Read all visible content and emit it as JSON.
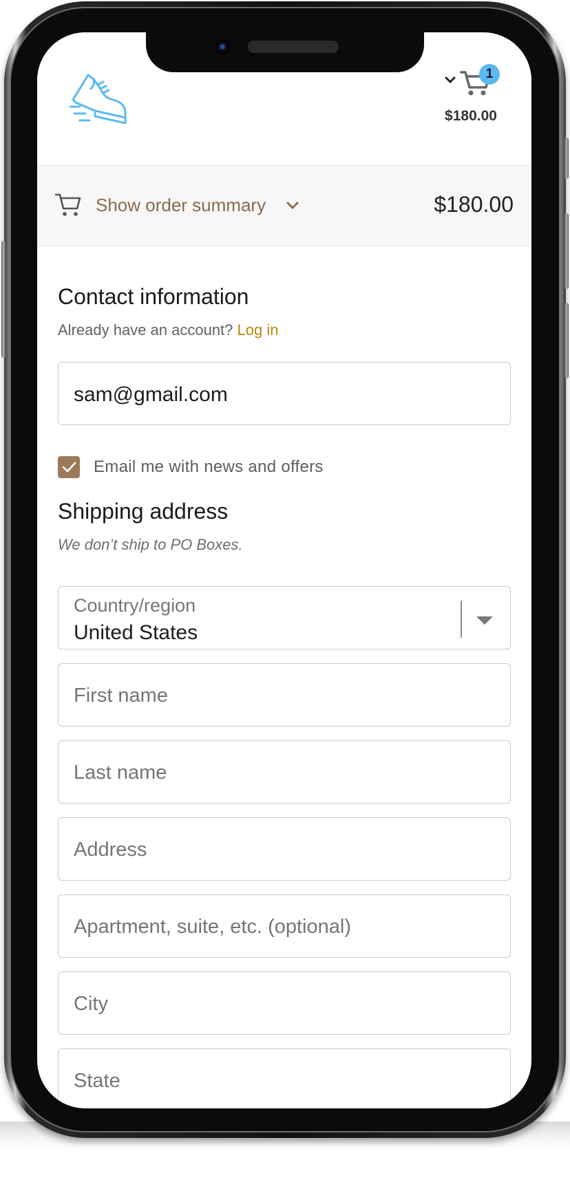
{
  "header": {
    "logo_icon": "running-shoe-icon",
    "cart_count": "1",
    "cart_total": "$180.00",
    "brand_color": "#5cb8f0"
  },
  "order_summary": {
    "toggle_label": "Show order summary",
    "total": "$180.00",
    "accent_color": "#8b6a4a"
  },
  "contact": {
    "heading": "Contact information",
    "account_prompt": "Already have an account?",
    "login_label": "Log in",
    "email_value": "sam@gmail.com",
    "newsletter_label": "Email me with news and offers",
    "newsletter_checked": true
  },
  "shipping": {
    "heading": "Shipping address",
    "note": "We don’t ship to PO Boxes.",
    "country_label": "Country/region",
    "country_value": "United States",
    "first_name_placeholder": "First name",
    "last_name_placeholder": "Last name",
    "address_placeholder": "Address",
    "apartment_placeholder": "Apartment, suite, etc. (optional)",
    "city_placeholder": "City",
    "state_placeholder": "State"
  }
}
